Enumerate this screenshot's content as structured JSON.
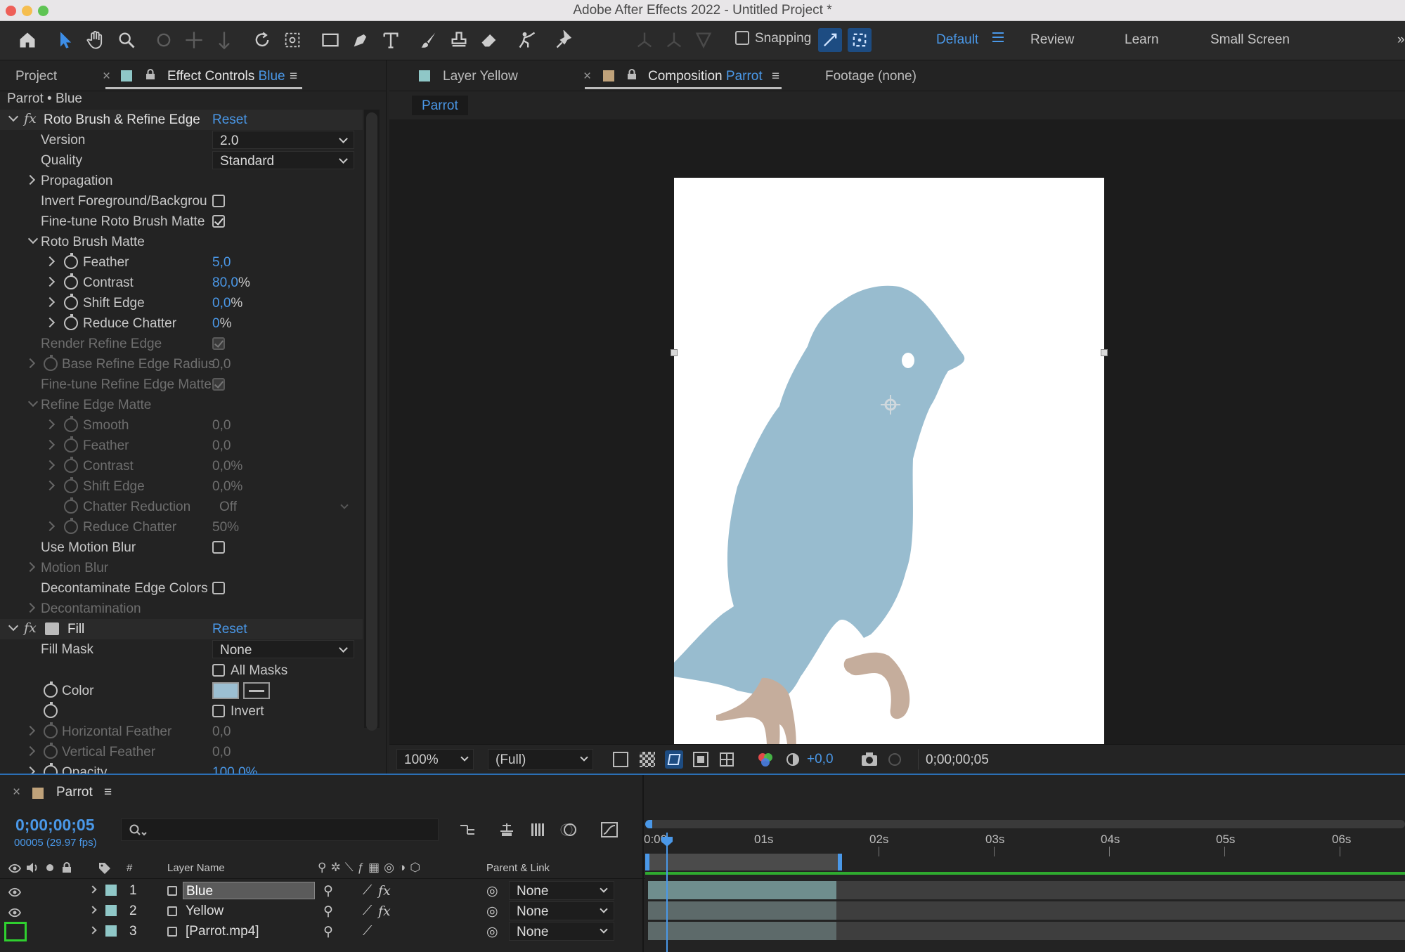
{
  "window": {
    "title": "Adobe After Effects 2022 - Untitled Project *"
  },
  "toolbar": {
    "tools": [
      "home-icon",
      "selection-tool-icon",
      "hand-tool-icon",
      "zoom-tool-icon",
      "orbit-camera-icon",
      "pan-camera-icon",
      "dolly-camera-icon",
      "rotation-tool-icon",
      "pan-behind-icon",
      "rectangle-tool-icon",
      "pen-tool-icon",
      "type-tool-icon",
      "brush-tool-icon",
      "clone-stamp-icon",
      "eraser-tool-icon",
      "roto-brush-icon",
      "puppet-pin-icon"
    ],
    "snapping_label": "Snapping",
    "workspaces": [
      "Default",
      "Review",
      "Learn",
      "Small Screen"
    ],
    "active_workspace": "Default"
  },
  "left_panel": {
    "tabs": {
      "project": "Project",
      "effect_controls": "Effect Controls",
      "effect_controls_layer": "Blue"
    },
    "breadcrumb": "Parrot • Blue",
    "roto": {
      "name": "Roto Brush & Refine Edge",
      "reset": "Reset",
      "version_label": "Version",
      "version_value": "2.0",
      "quality_label": "Quality",
      "quality_value": "Standard",
      "propagation": "Propagation",
      "invert": "Invert Foreground/Backgrou",
      "finetune": "Fine-tune Roto Brush Matte",
      "matte_group": "Roto Brush Matte",
      "feather_label": "Feather",
      "feather_value": "5,0",
      "contrast_label": "Contrast",
      "contrast_value": "80,0",
      "contrast_unit": "%",
      "shift_label": "Shift Edge",
      "shift_value": "0,0",
      "shift_unit": "%",
      "chatter_label": "Reduce Chatter",
      "chatter_value": "0",
      "chatter_unit": "%",
      "render_refine": "Render Refine Edge",
      "base_radius_label": "Base Refine Edge Radius",
      "base_radius_value": "0,0",
      "finetune_refine": "Fine-tune Refine Edge Matte",
      "refine_group": "Refine Edge Matte",
      "smooth_label": "Smooth",
      "smooth_value": "0,0",
      "r_feather_label": "Feather",
      "r_feather_value": "0,0",
      "r_contrast_label": "Contrast",
      "r_contrast_value": "0,0%",
      "r_shift_label": "Shift Edge",
      "r_shift_value": "0,0%",
      "chatter_red_label": "Chatter Reduction",
      "chatter_red_value": "Off",
      "r_chatter_label": "Reduce Chatter",
      "r_chatter_value": "50%",
      "motion_blur_use": "Use Motion Blur",
      "motion_blur": "Motion Blur",
      "decontam_colors": "Decontaminate Edge Colors",
      "decontam": "Decontamination"
    },
    "fill": {
      "name": "Fill",
      "reset": "Reset",
      "mask_label": "Fill Mask",
      "mask_value": "None",
      "all_masks": "All Masks",
      "color_label": "Color",
      "color_value": "#9cbfd2",
      "invert": "Invert",
      "h_feather_label": "Horizontal Feather",
      "h_feather_value": "0,0",
      "v_feather_label": "Vertical Feather",
      "v_feather_value": "0,0",
      "opacity_label": "Opacity",
      "opacity_value": "100,0%"
    }
  },
  "comp_panel": {
    "tabs": {
      "layer": "Layer Yellow",
      "composition": "Composition",
      "composition_name": "Parrot",
      "footage": "Footage (none)"
    },
    "sub_tab": "Parrot",
    "zoom": "100%",
    "resolution": "(Full)",
    "exposure": "+0,0",
    "timecode": "0;00;00;05",
    "colors": {
      "parrot_body": "#98bccf",
      "parrot_feet": "#c5ad9c"
    }
  },
  "timeline": {
    "comp_name": "Parrot",
    "timecode": "0;00;00;05",
    "frame_info": "00005 (29.97 fps)",
    "search_placeholder": "",
    "headers": {
      "num": "#",
      "layer_name": "Layer Name",
      "parent": "Parent & Link"
    },
    "ruler": [
      "0:00",
      "01s",
      "02s",
      "03s",
      "04s",
      "05s",
      "06s"
    ],
    "layers": [
      {
        "num": "1",
        "name": "Blue",
        "color": "#8fc7c7",
        "parent": "None"
      },
      {
        "num": "2",
        "name": "Yellow",
        "color": "#8fc7c7",
        "parent": "None"
      },
      {
        "num": "3",
        "name": "[Parrot.mp4]",
        "color": "#8fc7c7",
        "parent": "None"
      }
    ]
  }
}
